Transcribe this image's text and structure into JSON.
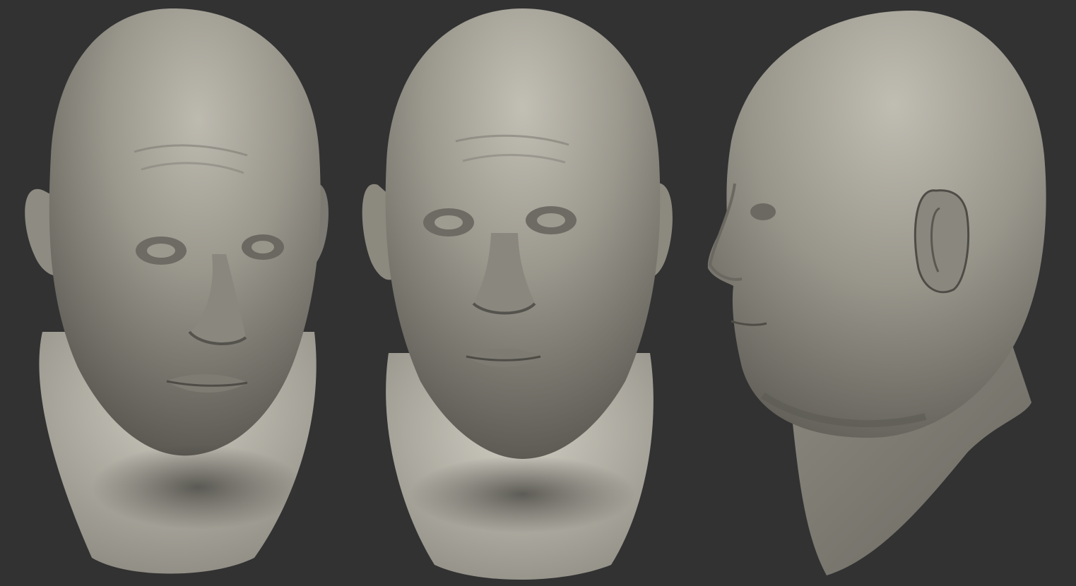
{
  "scene": {
    "background_color": "#323232",
    "material_color": "#8f8d84",
    "highlight_color": "#c9c6bb",
    "shadow_color": "#3a3935",
    "views": [
      {
        "id": "three-quarter",
        "description_icon": "head-three-quarter-render"
      },
      {
        "id": "front",
        "description_icon": "head-front-render"
      },
      {
        "id": "profile",
        "description_icon": "head-profile-render"
      }
    ]
  }
}
